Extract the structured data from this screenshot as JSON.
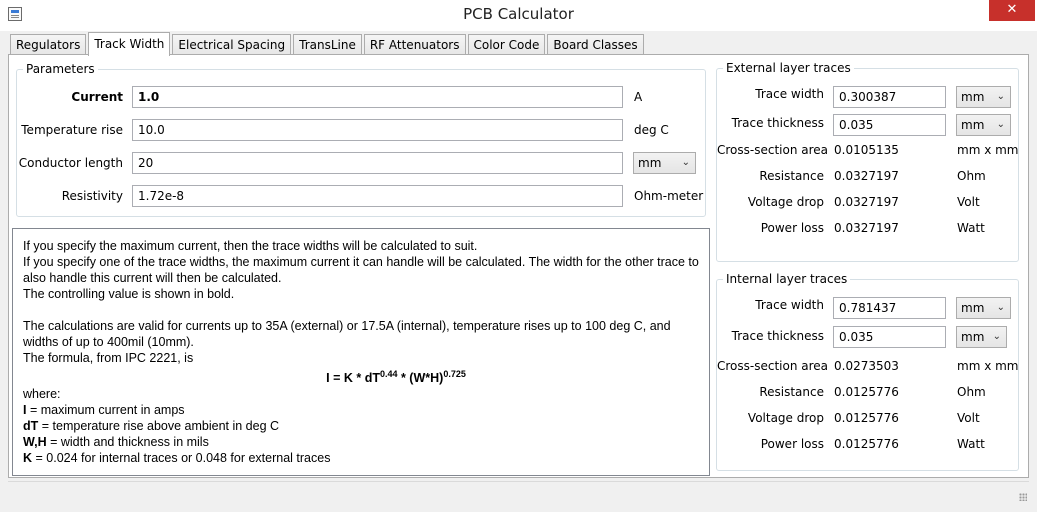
{
  "window": {
    "title": "PCB Calculator",
    "close_glyph": "✕"
  },
  "tabs": [
    {
      "label": "Regulators"
    },
    {
      "label": "Track Width"
    },
    {
      "label": "Electrical Spacing"
    },
    {
      "label": "TransLine"
    },
    {
      "label": "RF Attenuators"
    },
    {
      "label": "Color Code"
    },
    {
      "label": "Board Classes"
    }
  ],
  "parameters": {
    "legend": "Parameters",
    "current_label": "Current",
    "current_value": "1.0",
    "current_unit": "A",
    "temp_label": "Temperature rise",
    "temp_value": "10.0",
    "temp_unit": "deg C",
    "length_label": "Conductor length",
    "length_value": "20",
    "length_unit": "mm",
    "resistivity_label": "Resistivity",
    "resistivity_value": "1.72e-8",
    "resistivity_unit": "Ohm-meter"
  },
  "external": {
    "legend": "External layer traces",
    "width_label": "Trace width",
    "width_value": "0.300387",
    "width_unit": "mm",
    "thickness_label": "Trace thickness",
    "thickness_value": "0.035",
    "thickness_unit": "mm",
    "area_label": "Cross-section area",
    "area_value": "0.0105135",
    "area_unit": "mm x mm",
    "resistance_label": "Resistance",
    "resistance_value": "0.0327197",
    "resistance_unit": "Ohm",
    "vdrop_label": "Voltage drop",
    "vdrop_value": "0.0327197",
    "vdrop_unit": "Volt",
    "ploss_label": "Power loss",
    "ploss_value": "0.0327197",
    "ploss_unit": "Watt"
  },
  "internal": {
    "legend": "Internal layer traces",
    "width_label": "Trace width",
    "width_value": "0.781437",
    "width_unit": "mm",
    "thickness_label": "Trace thickness",
    "thickness_value": "0.035",
    "thickness_unit": "mm",
    "area_label": "Cross-section area",
    "area_value": "0.0273503",
    "area_unit": "mm x mm",
    "resistance_label": "Resistance",
    "resistance_value": "0.0125776",
    "resistance_unit": "Ohm",
    "vdrop_label": "Voltage drop",
    "vdrop_value": "0.0125776",
    "vdrop_unit": "Volt",
    "ploss_label": "Power loss",
    "ploss_value": "0.0125776",
    "ploss_unit": "Watt"
  },
  "info": {
    "line1": "If you specify the maximum current, then the trace widths will be calculated to suit.",
    "line2": "If you specify one of the trace widths, the maximum current it can handle will be calculated. The width for the other trace to also handle this current will then be calculated.",
    "line3": "The controlling value is shown in bold.",
    "line4": "The calculations are valid for currents up to 35A (external) or 17.5A (internal), temperature rises up to 100 deg C, and widths of up to 400mil (10mm).",
    "line5": "The formula, from IPC 2221, is",
    "formula_a": "I = K * dT",
    "formula_exp1": "0.44",
    "formula_b": " * (W*H)",
    "formula_exp2": "0.725",
    "where": "where:",
    "def_i_key": "I",
    "def_i_text": " = maximum current in amps",
    "def_dt_key": "dT",
    "def_dt_text": " = temperature rise above ambient in deg C",
    "def_wh_key": "W,H",
    "def_wh_text": " = width and thickness in mils",
    "def_k_key": "K",
    "def_k_text": " = 0.024 for internal traces or 0.048 for external traces"
  },
  "icons": {
    "chevron": "⌄"
  }
}
